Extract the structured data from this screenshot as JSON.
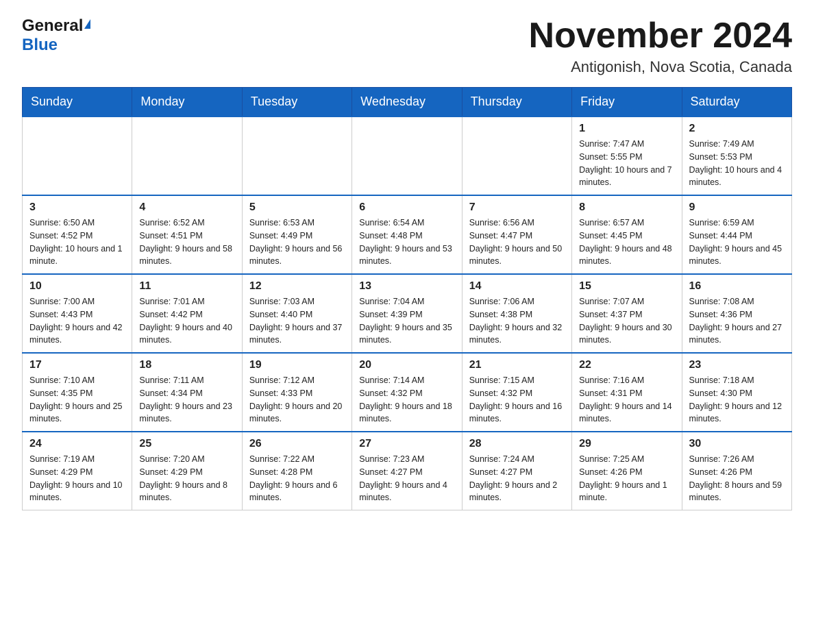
{
  "header": {
    "logo_general": "General",
    "logo_blue": "Blue",
    "month_title": "November 2024",
    "location": "Antigonish, Nova Scotia, Canada"
  },
  "weekdays": [
    "Sunday",
    "Monday",
    "Tuesday",
    "Wednesday",
    "Thursday",
    "Friday",
    "Saturday"
  ],
  "weeks": [
    [
      {
        "day": "",
        "info": ""
      },
      {
        "day": "",
        "info": ""
      },
      {
        "day": "",
        "info": ""
      },
      {
        "day": "",
        "info": ""
      },
      {
        "day": "",
        "info": ""
      },
      {
        "day": "1",
        "info": "Sunrise: 7:47 AM\nSunset: 5:55 PM\nDaylight: 10 hours and 7 minutes."
      },
      {
        "day": "2",
        "info": "Sunrise: 7:49 AM\nSunset: 5:53 PM\nDaylight: 10 hours and 4 minutes."
      }
    ],
    [
      {
        "day": "3",
        "info": "Sunrise: 6:50 AM\nSunset: 4:52 PM\nDaylight: 10 hours and 1 minute."
      },
      {
        "day": "4",
        "info": "Sunrise: 6:52 AM\nSunset: 4:51 PM\nDaylight: 9 hours and 58 minutes."
      },
      {
        "day": "5",
        "info": "Sunrise: 6:53 AM\nSunset: 4:49 PM\nDaylight: 9 hours and 56 minutes."
      },
      {
        "day": "6",
        "info": "Sunrise: 6:54 AM\nSunset: 4:48 PM\nDaylight: 9 hours and 53 minutes."
      },
      {
        "day": "7",
        "info": "Sunrise: 6:56 AM\nSunset: 4:47 PM\nDaylight: 9 hours and 50 minutes."
      },
      {
        "day": "8",
        "info": "Sunrise: 6:57 AM\nSunset: 4:45 PM\nDaylight: 9 hours and 48 minutes."
      },
      {
        "day": "9",
        "info": "Sunrise: 6:59 AM\nSunset: 4:44 PM\nDaylight: 9 hours and 45 minutes."
      }
    ],
    [
      {
        "day": "10",
        "info": "Sunrise: 7:00 AM\nSunset: 4:43 PM\nDaylight: 9 hours and 42 minutes."
      },
      {
        "day": "11",
        "info": "Sunrise: 7:01 AM\nSunset: 4:42 PM\nDaylight: 9 hours and 40 minutes."
      },
      {
        "day": "12",
        "info": "Sunrise: 7:03 AM\nSunset: 4:40 PM\nDaylight: 9 hours and 37 minutes."
      },
      {
        "day": "13",
        "info": "Sunrise: 7:04 AM\nSunset: 4:39 PM\nDaylight: 9 hours and 35 minutes."
      },
      {
        "day": "14",
        "info": "Sunrise: 7:06 AM\nSunset: 4:38 PM\nDaylight: 9 hours and 32 minutes."
      },
      {
        "day": "15",
        "info": "Sunrise: 7:07 AM\nSunset: 4:37 PM\nDaylight: 9 hours and 30 minutes."
      },
      {
        "day": "16",
        "info": "Sunrise: 7:08 AM\nSunset: 4:36 PM\nDaylight: 9 hours and 27 minutes."
      }
    ],
    [
      {
        "day": "17",
        "info": "Sunrise: 7:10 AM\nSunset: 4:35 PM\nDaylight: 9 hours and 25 minutes."
      },
      {
        "day": "18",
        "info": "Sunrise: 7:11 AM\nSunset: 4:34 PM\nDaylight: 9 hours and 23 minutes."
      },
      {
        "day": "19",
        "info": "Sunrise: 7:12 AM\nSunset: 4:33 PM\nDaylight: 9 hours and 20 minutes."
      },
      {
        "day": "20",
        "info": "Sunrise: 7:14 AM\nSunset: 4:32 PM\nDaylight: 9 hours and 18 minutes."
      },
      {
        "day": "21",
        "info": "Sunrise: 7:15 AM\nSunset: 4:32 PM\nDaylight: 9 hours and 16 minutes."
      },
      {
        "day": "22",
        "info": "Sunrise: 7:16 AM\nSunset: 4:31 PM\nDaylight: 9 hours and 14 minutes."
      },
      {
        "day": "23",
        "info": "Sunrise: 7:18 AM\nSunset: 4:30 PM\nDaylight: 9 hours and 12 minutes."
      }
    ],
    [
      {
        "day": "24",
        "info": "Sunrise: 7:19 AM\nSunset: 4:29 PM\nDaylight: 9 hours and 10 minutes."
      },
      {
        "day": "25",
        "info": "Sunrise: 7:20 AM\nSunset: 4:29 PM\nDaylight: 9 hours and 8 minutes."
      },
      {
        "day": "26",
        "info": "Sunrise: 7:22 AM\nSunset: 4:28 PM\nDaylight: 9 hours and 6 minutes."
      },
      {
        "day": "27",
        "info": "Sunrise: 7:23 AM\nSunset: 4:27 PM\nDaylight: 9 hours and 4 minutes."
      },
      {
        "day": "28",
        "info": "Sunrise: 7:24 AM\nSunset: 4:27 PM\nDaylight: 9 hours and 2 minutes."
      },
      {
        "day": "29",
        "info": "Sunrise: 7:25 AM\nSunset: 4:26 PM\nDaylight: 9 hours and 1 minute."
      },
      {
        "day": "30",
        "info": "Sunrise: 7:26 AM\nSunset: 4:26 PM\nDaylight: 8 hours and 59 minutes."
      }
    ]
  ]
}
